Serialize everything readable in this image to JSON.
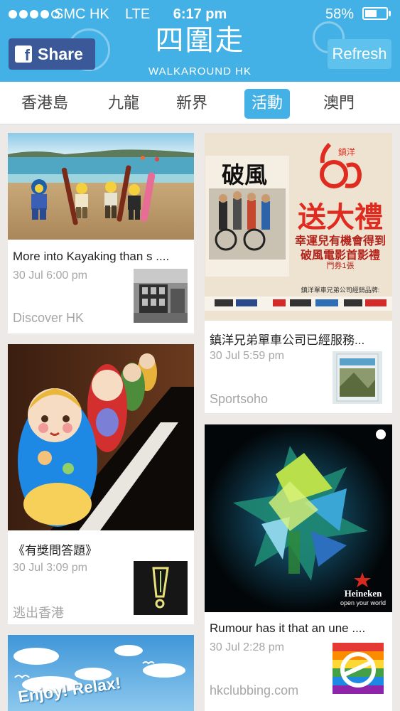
{
  "status_bar": {
    "carrier": "SMC HK",
    "network": "LTE",
    "time": "6:17 pm",
    "battery": "58%",
    "battery_level": 0.58
  },
  "header": {
    "title": "四圍走",
    "subtitle": "WALKAROUND HK",
    "share_label": "Share",
    "share_icon": "facebook-icon",
    "refresh_label": "Refresh"
  },
  "tabs": [
    {
      "label": "香港島",
      "active": false
    },
    {
      "label": "九龍",
      "active": false
    },
    {
      "label": "新界",
      "active": false
    },
    {
      "label": "活動",
      "active": true
    },
    {
      "label": "澳門",
      "active": false
    }
  ],
  "feed": {
    "left": [
      {
        "title": "More into Kayaking than s ....",
        "time": "30 Jul 6:00 pm",
        "source": "Discover HK"
      },
      {
        "title": "《有獎問答題》",
        "time": "30 Jul 3:09 pm",
        "source": "逃出香港"
      },
      {
        "title": "",
        "time": "",
        "source": ""
      }
    ],
    "right": [
      {
        "title": "鎮洋兄弟單車公司已經服務...",
        "time": "30 Jul 5:59 pm",
        "source": "Sportsoho"
      },
      {
        "title": "Rumour has it that an une ....",
        "time": "30 Jul 2:28 pm",
        "source": "hkclubbing.com"
      }
    ]
  },
  "image_text": {
    "promo_number": "65",
    "promo_brand": "鎮洋",
    "promo_headline": "送大禮",
    "promo_line1": "幸運兒有機會得到",
    "promo_line2": "破風電影首影禮",
    "promo_line3": "門券1張",
    "promo_sponsor_line": "鎮洋單車兄弟公司經銷品牌:",
    "poster_title": "破風",
    "beer_brand": "Heineken",
    "beer_tagline": "open your world",
    "enjoy_text": "Enjoy! Relax!"
  },
  "colors": {
    "header_bg": "#43b1e5",
    "facebook": "#3b5998",
    "tab_active": "#43b1e5",
    "promo_red": "#e02b20"
  }
}
